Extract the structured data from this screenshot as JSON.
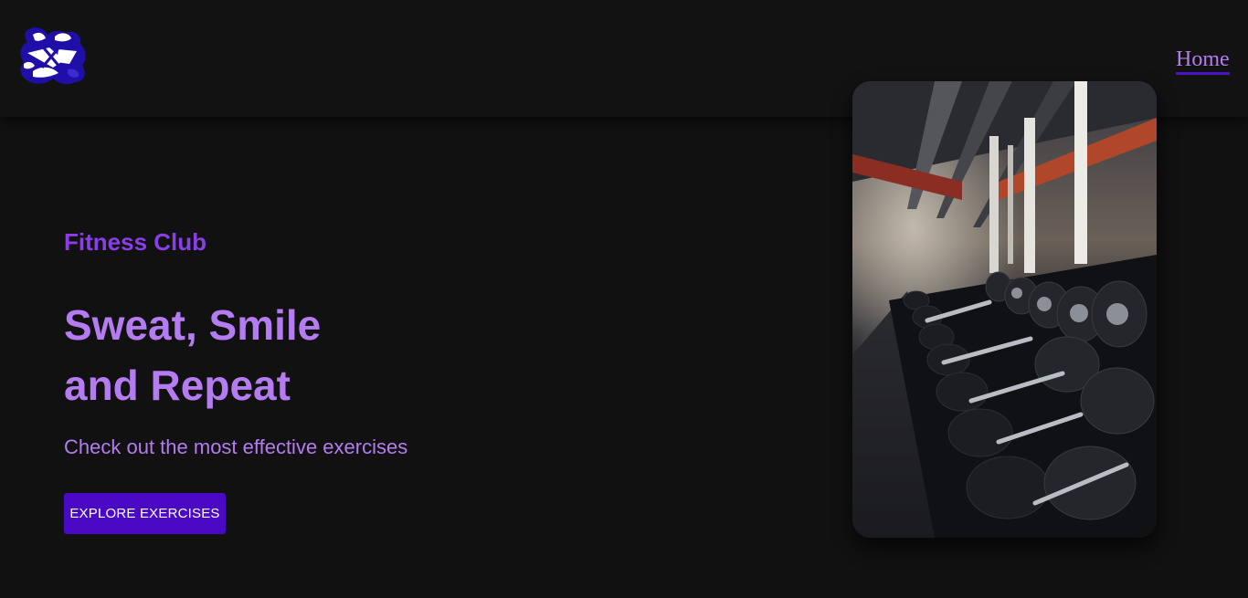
{
  "nav": {
    "logo_icon": "fitness-logo-icon",
    "links": [
      {
        "label": "Home",
        "active": true
      }
    ]
  },
  "hero": {
    "eyebrow": "Fitness Club",
    "headline_line1": "Sweat, Smile",
    "headline_line2": "and Repeat",
    "subtitle": "Check out the most effective exercises",
    "cta_label": "EXPLORE EXERCISES"
  },
  "image": {
    "subject": "dumbbell-rack-photo"
  },
  "colors": {
    "background": "#111111",
    "navbar": "#121212",
    "accent_purple": "#8a3fe6",
    "text_lavender": "#b47cf0",
    "button": "#4a09c4",
    "nav_underline": "#4a15c9"
  }
}
